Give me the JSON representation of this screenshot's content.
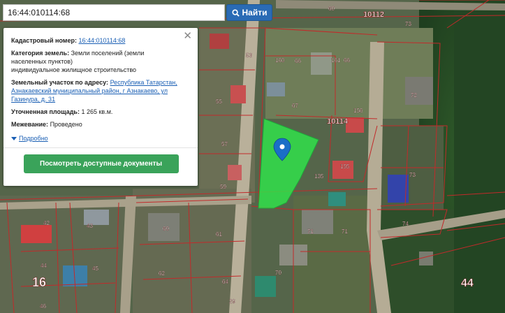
{
  "search": {
    "value": "16:44:010114:68",
    "button_label": "Найти"
  },
  "panel": {
    "cadastral_label": "Кадастровый номер:",
    "cadastral_value": "16:44:010114:68",
    "category_label": "Категория земель:",
    "category_value_line1": "Земли поселений (земли",
    "category_value_line2": "населенных пунктов)",
    "category_value_line3": "индивидуальное жилищное строительство",
    "address_label": "Земельный участок по адресу:",
    "address_line1": "Республика Татарстан,",
    "address_line2": "Азнакаевский муниципальный район, г Азнакаево, ул",
    "address_line3": "Газинура, д. 31",
    "area_label": "Уточненная площадь:",
    "area_value": "1 265 кв.м.",
    "survey_label": "Межевание:",
    "survey_value": "Проведено",
    "more_label": "Подробно",
    "docs_button": "Посмотреть доступные документы"
  },
  "map": {
    "parcel_color": "#2ee84a",
    "boundary_color": "#c22a2a",
    "quarter_labels": [
      "10112",
      "10114",
      "16",
      "44"
    ],
    "plot_labels": [
      "73",
      "53",
      "160",
      "66",
      "161",
      "66",
      "72",
      "55",
      "67",
      "156",
      "57",
      "155",
      "73",
      "59",
      "135",
      "74",
      "42",
      "43",
      "60",
      "61",
      "71",
      "71",
      "44",
      "45",
      "62",
      "70",
      "64",
      "46",
      "29",
      "60"
    ]
  }
}
